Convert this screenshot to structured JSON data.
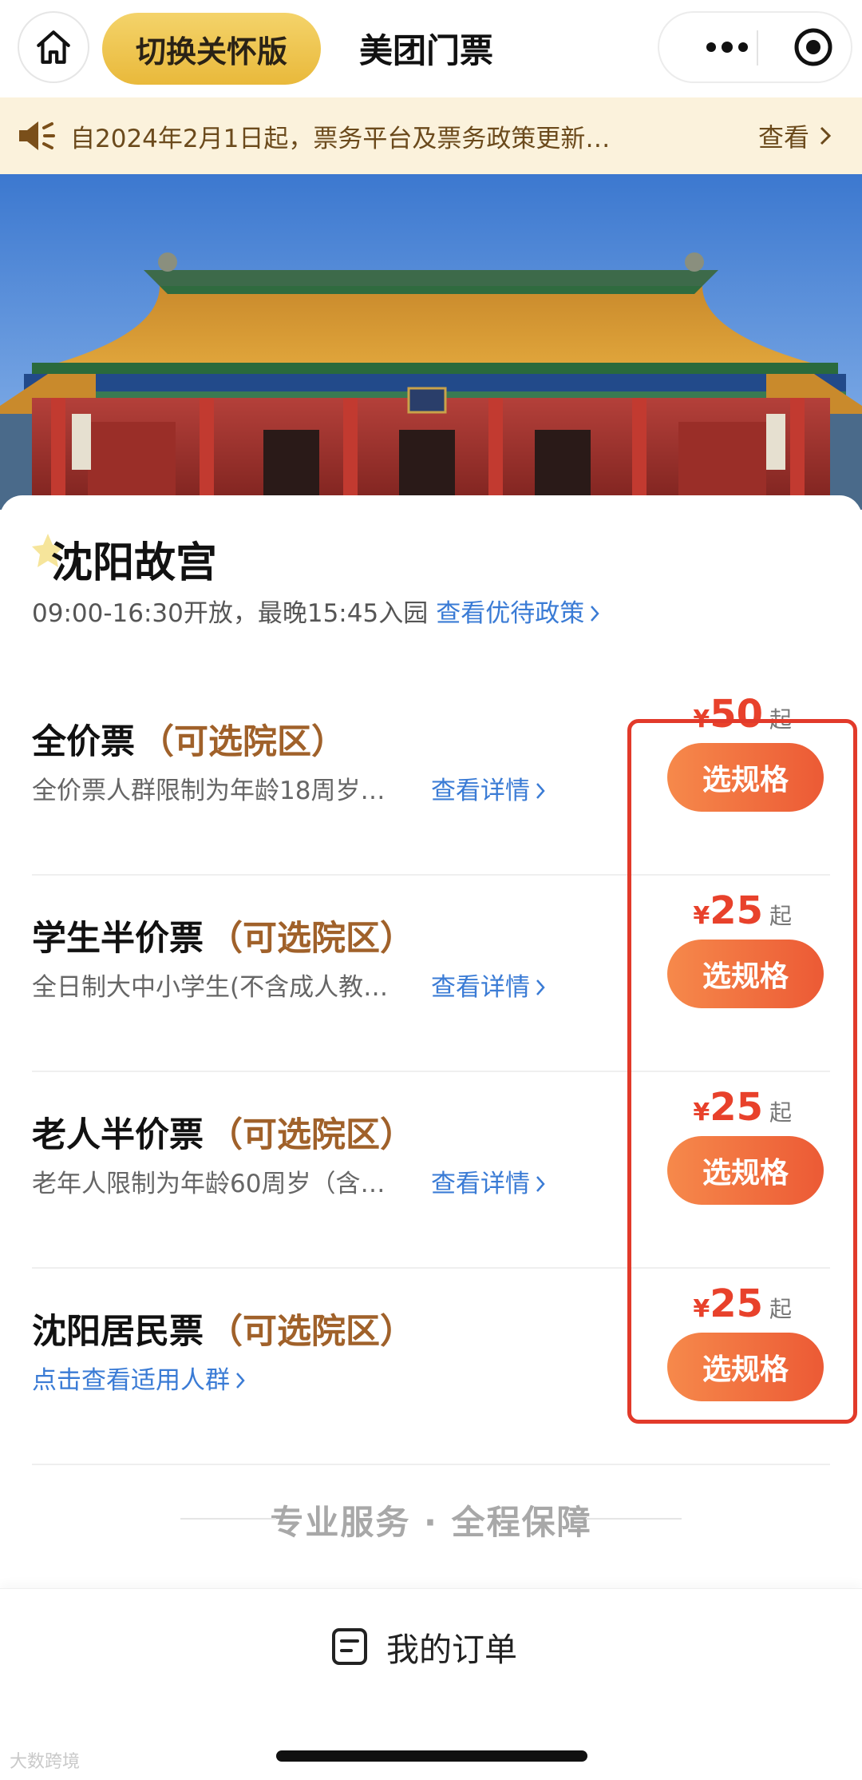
{
  "topbar": {
    "care_mode_label": "切换关怀版",
    "title": "美团门票",
    "icons": [
      "home-icon",
      "more-dots-icon",
      "target-icon"
    ]
  },
  "notice": {
    "text": "自2024年2月1日起，票务平台及票务政策更新…",
    "action": "查看",
    "icon": "speaker-icon"
  },
  "scenic": {
    "name": "沈阳故宫",
    "hours": "09:00-16:30开放，最晚15:45入园",
    "policy_link": "查看优待政策"
  },
  "tickets": [
    {
      "title": "全价票",
      "tag": "（可选院区）",
      "desc": "全价票人群限制为年龄18周岁…",
      "link": "查看详情",
      "currency": "¥",
      "price": "50",
      "suffix": "起",
      "button": "选规格"
    },
    {
      "title": "学生半价票",
      "tag": "（可选院区）",
      "desc": "全日制大中小学生(不含成人教…",
      "link": "查看详情",
      "currency": "¥",
      "price": "25",
      "suffix": "起",
      "button": "选规格"
    },
    {
      "title": "老人半价票",
      "tag": "（可选院区）",
      "desc": "老年人限制为年龄60周岁（含…",
      "link": "查看详情",
      "currency": "¥",
      "price": "25",
      "suffix": "起",
      "button": "选规格"
    },
    {
      "title": "沈阳居民票",
      "tag": "（可选院区）",
      "desc": "",
      "link": "点击查看适用人群",
      "currency": "¥",
      "price": "25",
      "suffix": "起",
      "button": "选规格"
    }
  ],
  "service": {
    "text": "专业服务 · 全程保障"
  },
  "bottom": {
    "orders_label": "我的订单",
    "watermark": "大数跨境"
  },
  "colors": {
    "accent": "#ec5a35",
    "price": "#e8412b",
    "link": "#3a7bd5",
    "tag": "#a0612a",
    "highlight": "#e23a2a",
    "care_button": "#f0c44f"
  }
}
